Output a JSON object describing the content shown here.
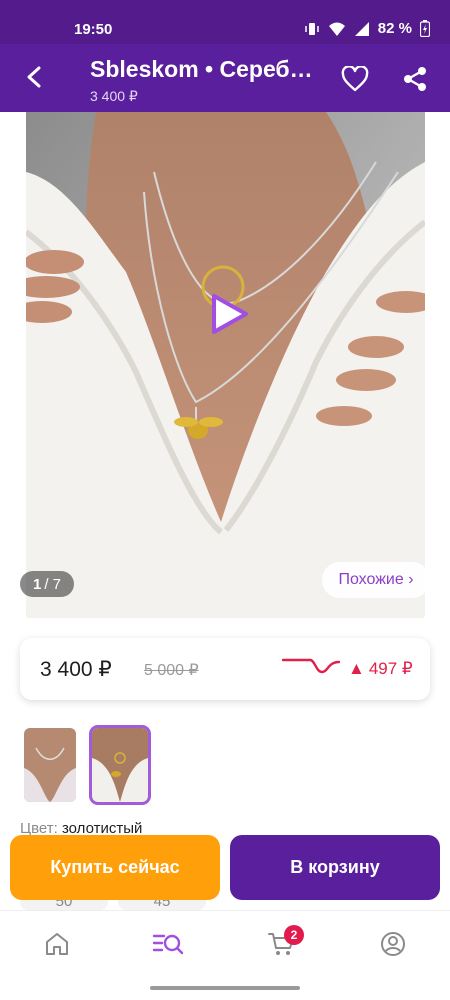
{
  "status_bar": {
    "time": "19:50",
    "battery": "82 %"
  },
  "app_bar": {
    "title": "Sbleskom • Сереб…",
    "subtitle": "3 400 ₽"
  },
  "gallery": {
    "counter_current": "1",
    "counter_total": "/ 7",
    "similar_label": "Похожие ›"
  },
  "price": {
    "current": "3 400 ₽",
    "old": "5 000 ₽",
    "change": "497 ₽",
    "change_arrow": "▲"
  },
  "product": {
    "color_label": "Цвет: ",
    "color_value": "золотистый",
    "sizes": [
      "50",
      "45"
    ]
  },
  "actions": {
    "buy_now": "Купить сейчас",
    "to_cart": "В корзину"
  },
  "bottom_nav": {
    "cart_count": "2"
  },
  "colors": {
    "brand": "#5a1f9c",
    "accent_orange": "#ff9f0a",
    "price_up": "#e0204a",
    "similar_link": "#8b3fc7"
  }
}
